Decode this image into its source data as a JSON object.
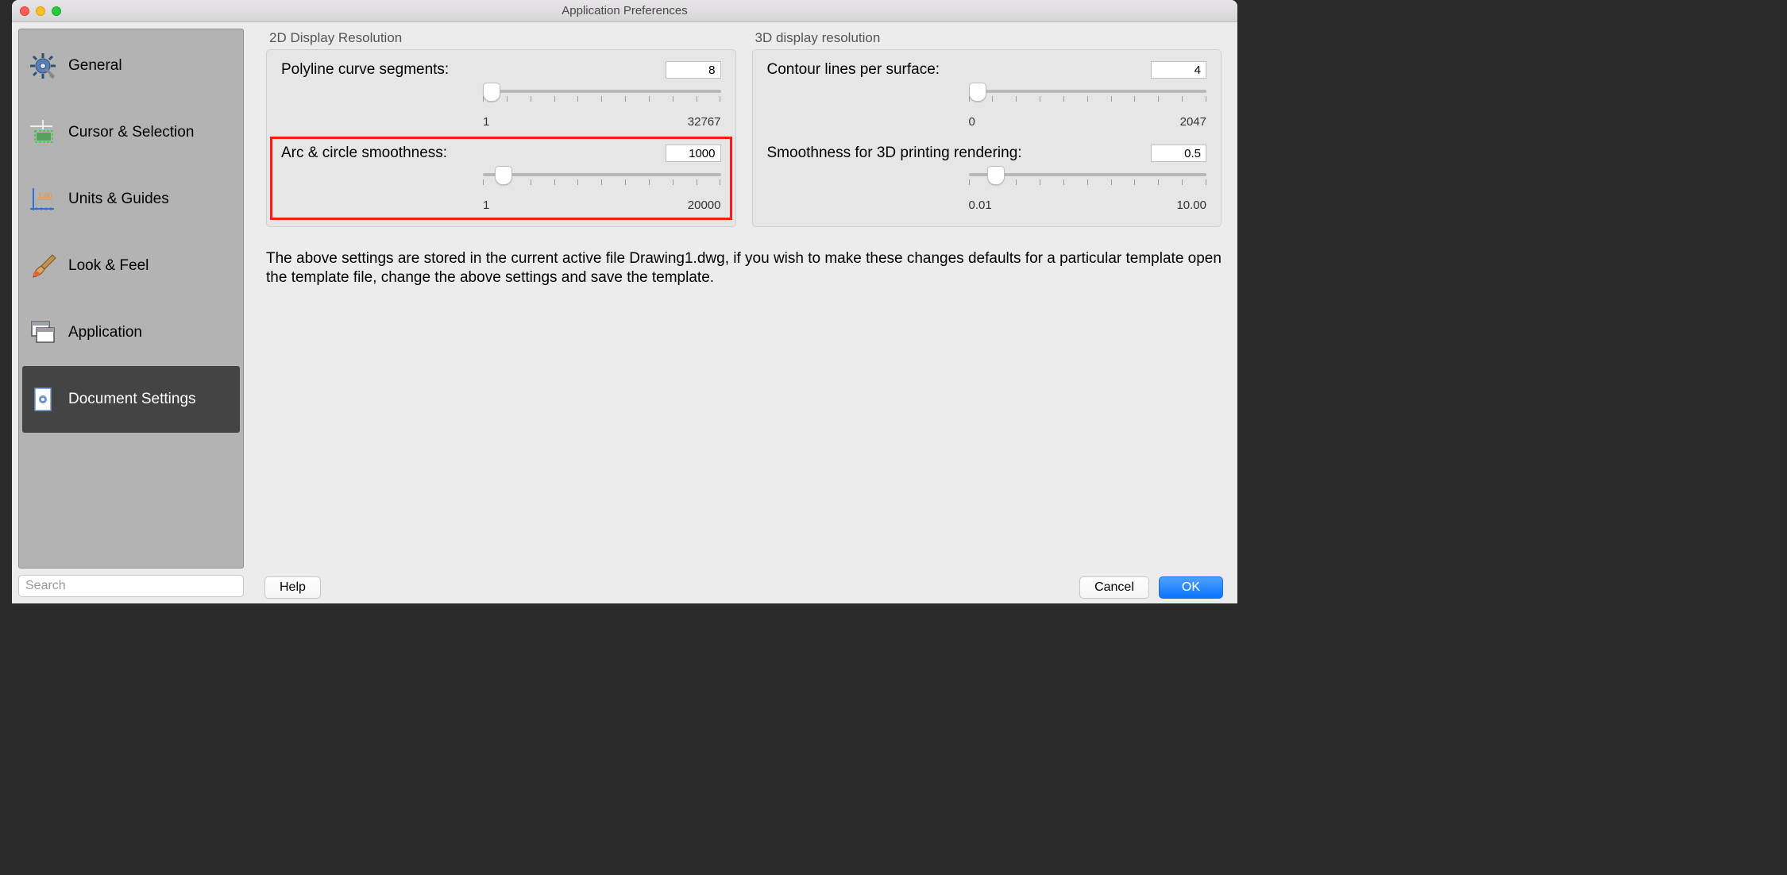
{
  "window": {
    "title": "Application Preferences"
  },
  "sidebar": {
    "search_placeholder": "Search",
    "items": [
      {
        "label": "General"
      },
      {
        "label": "Cursor & Selection"
      },
      {
        "label": "Units & Guides"
      },
      {
        "label": "Look & Feel"
      },
      {
        "label": "Application"
      },
      {
        "label": "Document Settings"
      }
    ],
    "selected_index": 5
  },
  "panels": {
    "left": {
      "title": "2D Display Resolution",
      "settings": [
        {
          "label": "Polyline curve segments:",
          "value": "8",
          "min_label": "1",
          "max_label": "32767",
          "thumb_pct": 0
        },
        {
          "label": "Arc & circle smoothness:",
          "value": "1000",
          "min_label": "1",
          "max_label": "20000",
          "thumb_pct": 5,
          "highlight": true
        }
      ]
    },
    "right": {
      "title": "3D display resolution",
      "settings": [
        {
          "label": "Contour lines per surface:",
          "value": "4",
          "min_label": "0",
          "max_label": "2047",
          "thumb_pct": 0
        },
        {
          "label": "Smoothness for 3D printing rendering:",
          "value": "0.5",
          "min_label": "0.01",
          "max_label": "10.00",
          "thumb_pct": 8
        }
      ]
    }
  },
  "note": "The above settings are stored in the current active file Drawing1.dwg, if you wish to make these changes defaults for a particular template open the template file, change the above settings and save the template.",
  "buttons": {
    "help": "Help",
    "cancel": "Cancel",
    "ok": "OK"
  }
}
